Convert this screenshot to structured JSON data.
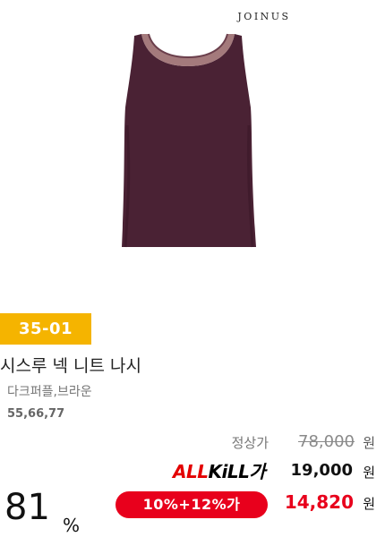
{
  "product": {
    "brand": "JOINUS",
    "code": "35-01",
    "name": "시스루 넥 니트 나시",
    "color": "다크퍼플,브라운",
    "sizes": "55,66,77",
    "image_icon": "sleeveless-knit-top-image"
  },
  "pricing": {
    "regular_label": "정상가",
    "regular_price": "78,000",
    "currency": "원",
    "allkill_label_red": "ALL",
    "allkill_label_black": "KiLL가",
    "allkill_price": "19,000",
    "discount_label": "10%+12%가",
    "final_price": "14,820",
    "discount_rate": "81",
    "percent_sign": "%"
  },
  "colors": {
    "badge": "#f5b400",
    "accent_red": "#e8001c",
    "garment": "#4a2234"
  }
}
